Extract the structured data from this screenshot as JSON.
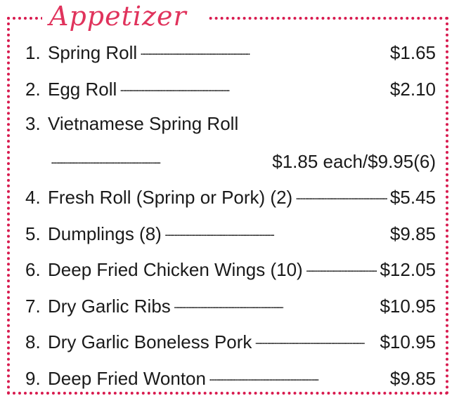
{
  "section": {
    "title": "Appetizer"
  },
  "items": [
    {
      "num": "1.",
      "name": "Spring Roll",
      "price": "$1.65"
    },
    {
      "num": "2.",
      "name": "Egg Roll",
      "price": "$2.10"
    },
    {
      "num": "3.",
      "name": "Vietnamese Spring Roll",
      "price": ""
    },
    {
      "num": "",
      "name": "",
      "price": "$1.85 each/$9.95(6)"
    },
    {
      "num": "4.",
      "name": "Fresh Roll (Sprinp or Pork) (2)",
      "price": "$5.45"
    },
    {
      "num": "5.",
      "name": "Dumplings (8)",
      "price": "$9.85"
    },
    {
      "num": "6.",
      "name": "Deep Fried Chicken Wings (10)",
      "price": "$12.05"
    },
    {
      "num": "7.",
      "name": "Dry Garlic Ribs",
      "price": "$10.95"
    },
    {
      "num": "8.",
      "name": "Dry Garlic Boneless Pork",
      "price": "$10.95"
    },
    {
      "num": "9.",
      "name": "Deep Fried Wonton",
      "price": "$9.85"
    }
  ],
  "colors": {
    "accent": "#e0335c",
    "border": "#d81b4f",
    "text": "#1a1a1a"
  }
}
